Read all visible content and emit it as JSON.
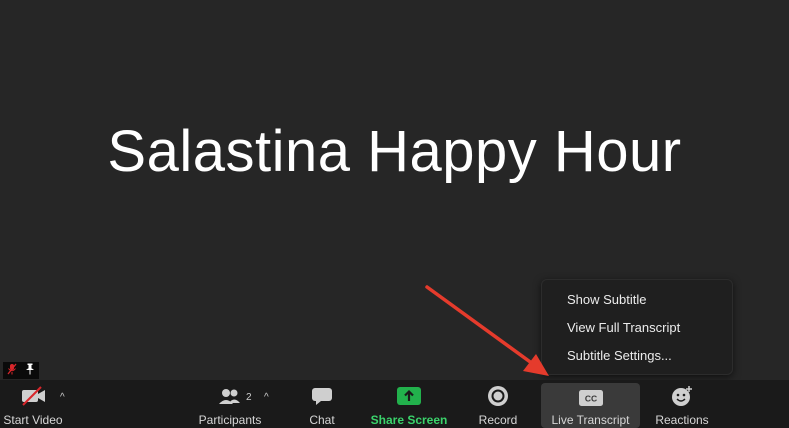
{
  "meeting": {
    "title": "Salastina Happy Hour"
  },
  "subtitle_menu": {
    "items": [
      {
        "label": "Show Subtitle"
      },
      {
        "label": "View Full Transcript"
      },
      {
        "label": "Subtitle Settings..."
      }
    ]
  },
  "toolbar": {
    "start_video": {
      "label": "Start Video",
      "icon": "video-off-icon"
    },
    "participants": {
      "label": "Participants",
      "count": "2",
      "icon": "participants-icon"
    },
    "chat": {
      "label": "Chat",
      "icon": "chat-icon"
    },
    "share_screen": {
      "label": "Share Screen",
      "icon": "share-screen-icon"
    },
    "record": {
      "label": "Record",
      "icon": "record-icon"
    },
    "live_transcript": {
      "label": "Live Transcript",
      "icon": "cc-icon",
      "badge": "CC"
    },
    "reactions": {
      "label": "Reactions",
      "icon": "reactions-icon"
    }
  },
  "colors": {
    "stage_bg": "#262626",
    "toolbar_bg": "#1a1a1a",
    "share_green": "#3ad36b",
    "mute_red": "#d9262b",
    "arrow_red": "#e53b2c"
  }
}
